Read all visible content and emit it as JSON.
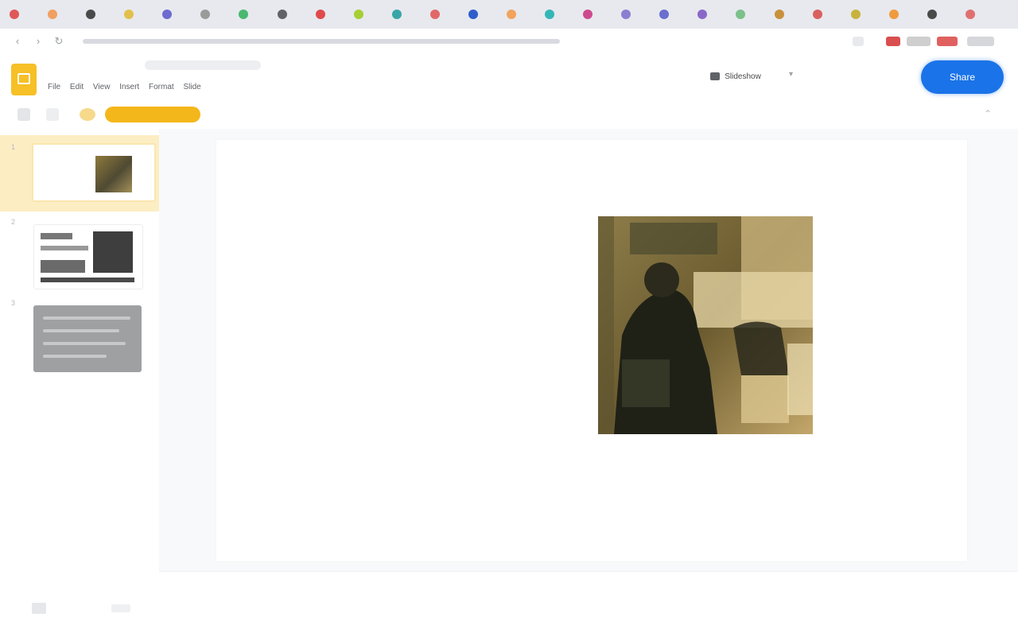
{
  "browser": {
    "tab_favicon_colors": [
      "#e05757",
      "#f0a060",
      "#4a4a4a",
      "#e3c04c",
      "#6b6bd0",
      "#9a9a9a",
      "#48b970",
      "#5f6368",
      "#df4b4b",
      "#a6cf33",
      "#38a6a6",
      "#e26868",
      "#2f5ecb",
      "#f2a35d",
      "#34b6b6",
      "#ce4a8e",
      "#8a7fd0",
      "#6a6fd0",
      "#8a68c8",
      "#7cc08a",
      "#c9903c",
      "#d96060",
      "#c9b23c",
      "#f09a3e",
      "#4a4a4a",
      "#e07070"
    ],
    "url_text": "",
    "extension_colors": [
      "#d94f4f",
      "#cfcfcf",
      "#e06060"
    ]
  },
  "app": {
    "title": "",
    "menu_items": [
      "File",
      "Edit",
      "View",
      "Insert",
      "Format",
      "Slide"
    ],
    "slideshow_label": "Slideshow",
    "present_label": "",
    "share_label": "Share",
    "toolbar_chip_label": "",
    "accent_color": "#f4b71b",
    "share_color": "#1a73e8"
  },
  "filmstrip": {
    "slides": [
      {
        "number": "1",
        "selected": true
      },
      {
        "number": "2",
        "selected": false
      },
      {
        "number": "3",
        "selected": false
      }
    ]
  },
  "slide": {
    "title_placeholder": "",
    "image_icon": "painting-image"
  },
  "notes": {
    "placeholder": ""
  }
}
